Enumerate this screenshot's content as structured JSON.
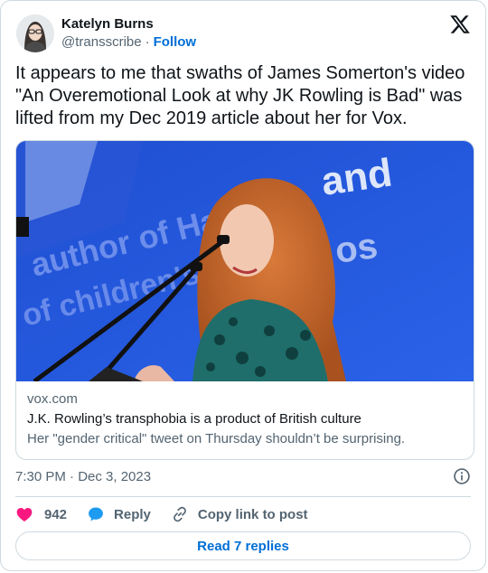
{
  "author": {
    "name": "Katelyn Burns",
    "handle": "@transscribe",
    "separator": "·",
    "follow_label": "Follow"
  },
  "tweet": {
    "text": "It appears to me that swaths of James Somerton's video \"An Overemotional Look at why JK Rowling is Bad\" was lifted from my Dec 2019 article about her for Vox."
  },
  "card": {
    "domain": "vox.com",
    "title": "J.K. Rowling’s transphobia is a product of British culture",
    "description": "Her \"gender critical\" tweet on Thursday shouldn’t be surprising.",
    "image_text": [
      "and",
      "author of Har",
      "of children's",
      "os"
    ]
  },
  "meta": {
    "timestamp": "7:30 PM · Dec 3, 2023"
  },
  "actions": {
    "like_count": "942",
    "reply_label": "Reply",
    "copy_label": "Copy link to post"
  },
  "footer": {
    "read_replies_label": "Read 7 replies"
  },
  "colors": {
    "accent": "#006fd6",
    "like": "#f91880",
    "reply": "#1d9bf0",
    "muted": "#536471",
    "border": "#cfd9de"
  },
  "icons": {
    "logo": "x-logo-icon",
    "info": "info-icon",
    "like": "heart-icon",
    "reply": "speech-bubble-icon",
    "copy": "link-icon"
  }
}
